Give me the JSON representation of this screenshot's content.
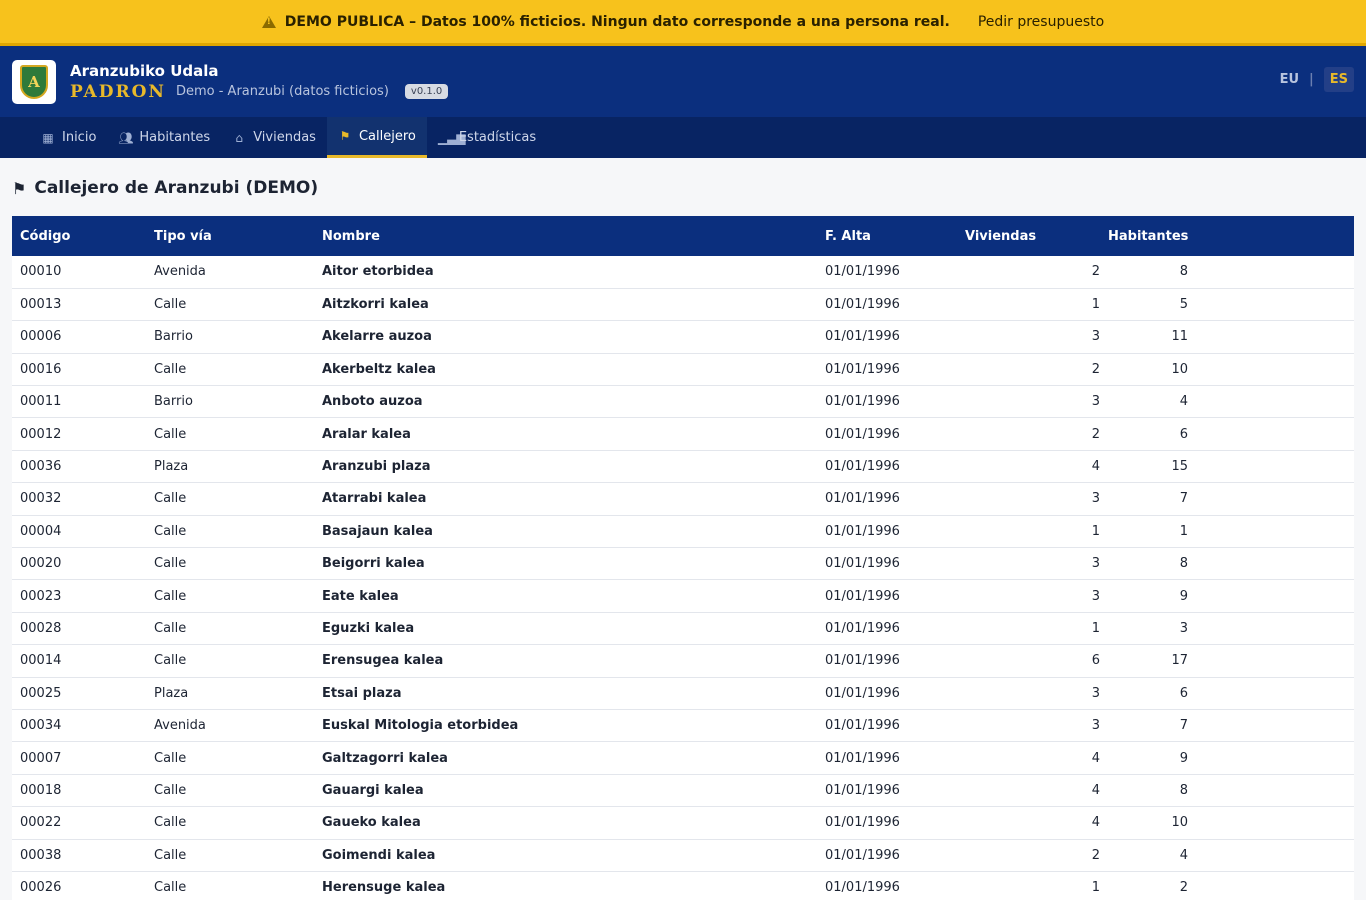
{
  "banner": {
    "warning": "DEMO PUBLICA – Datos 100% ficticios. Ningun dato corresponde a una persona real.",
    "budget_link": "Pedir presupuesto"
  },
  "header": {
    "logo_letter": "A",
    "town": "Aranzubiko Udala",
    "product": "PADRON",
    "subtitle": "Demo - Aranzubi (datos ficticios)",
    "version": "v0.1.0",
    "lang_eu": "EU",
    "lang_sep": "|",
    "lang_es": "ES"
  },
  "nav": [
    {
      "label": "Inicio",
      "icon": "dashboard-icon"
    },
    {
      "label": "Habitantes",
      "icon": "people-icon"
    },
    {
      "label": "Viviendas",
      "icon": "home-icon"
    },
    {
      "label": "Callejero",
      "icon": "signpost-icon",
      "active": true
    },
    {
      "label": "Estadísticas",
      "icon": "chart-icon"
    }
  ],
  "page": {
    "title": "Callejero de Aranzubi (DEMO)"
  },
  "table": {
    "headers": [
      "Código",
      "Tipo vía",
      "Nombre",
      "F. Alta",
      "Viviendas",
      "Habitantes"
    ],
    "rows": [
      [
        "00010",
        "Avenida",
        "Aitor etorbidea",
        "01/01/1996",
        "2",
        "8"
      ],
      [
        "00013",
        "Calle",
        "Aitzkorri kalea",
        "01/01/1996",
        "1",
        "5"
      ],
      [
        "00006",
        "Barrio",
        "Akelarre auzoa",
        "01/01/1996",
        "3",
        "11"
      ],
      [
        "00016",
        "Calle",
        "Akerbeltz kalea",
        "01/01/1996",
        "2",
        "10"
      ],
      [
        "00011",
        "Barrio",
        "Anboto auzoa",
        "01/01/1996",
        "3",
        "4"
      ],
      [
        "00012",
        "Calle",
        "Aralar kalea",
        "01/01/1996",
        "2",
        "6"
      ],
      [
        "00036",
        "Plaza",
        "Aranzubi plaza",
        "01/01/1996",
        "4",
        "15"
      ],
      [
        "00032",
        "Calle",
        "Atarrabi kalea",
        "01/01/1996",
        "3",
        "7"
      ],
      [
        "00004",
        "Calle",
        "Basajaun kalea",
        "01/01/1996",
        "1",
        "1"
      ],
      [
        "00020",
        "Calle",
        "Beigorri kalea",
        "01/01/1996",
        "3",
        "8"
      ],
      [
        "00023",
        "Calle",
        "Eate kalea",
        "01/01/1996",
        "3",
        "9"
      ],
      [
        "00028",
        "Calle",
        "Eguzki kalea",
        "01/01/1996",
        "1",
        "3"
      ],
      [
        "00014",
        "Calle",
        "Erensugea kalea",
        "01/01/1996",
        "6",
        "17"
      ],
      [
        "00025",
        "Plaza",
        "Etsai plaza",
        "01/01/1996",
        "3",
        "6"
      ],
      [
        "00034",
        "Avenida",
        "Euskal Mitologia etorbidea",
        "01/01/1996",
        "3",
        "7"
      ],
      [
        "00007",
        "Calle",
        "Galtzagorri kalea",
        "01/01/1996",
        "4",
        "9"
      ],
      [
        "00018",
        "Calle",
        "Gauargi kalea",
        "01/01/1996",
        "4",
        "8"
      ],
      [
        "00022",
        "Calle",
        "Gaueko kalea",
        "01/01/1996",
        "4",
        "10"
      ],
      [
        "00038",
        "Calle",
        "Goimendi kalea",
        "01/01/1996",
        "2",
        "4"
      ],
      [
        "00026",
        "Calle",
        "Herensuge kalea",
        "01/01/1996",
        "1",
        "2"
      ]
    ]
  }
}
